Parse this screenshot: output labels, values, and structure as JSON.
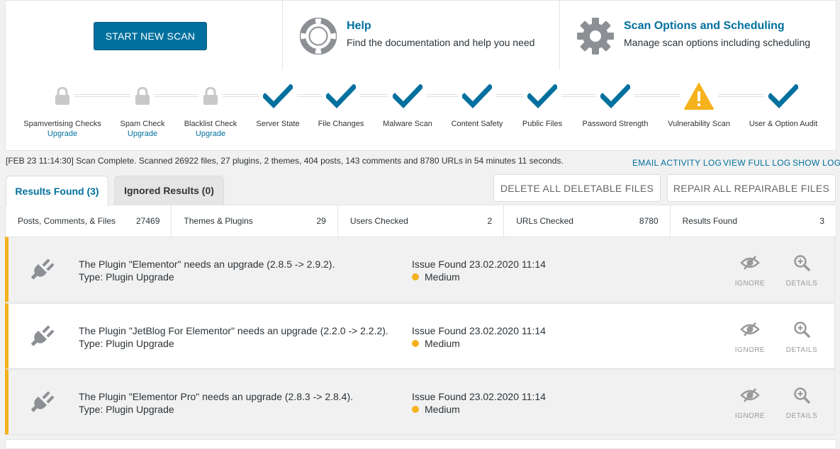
{
  "top": {
    "start_label": "START NEW SCAN",
    "help_title": "Help",
    "help_sub": "Find the documentation and help you need",
    "options_title": "Scan Options and Scheduling",
    "options_sub": "Manage scan options including scheduling"
  },
  "steps": [
    {
      "label": "Spamvertising Checks",
      "upgrade": "Upgrade",
      "icon": "lock-icon"
    },
    {
      "label": "Spam Check",
      "upgrade": "Upgrade",
      "icon": "lock-icon"
    },
    {
      "label": "Blacklist Check",
      "upgrade": "Upgrade",
      "icon": "lock-icon"
    },
    {
      "label": "Server State",
      "upgrade": "",
      "icon": "check-icon"
    },
    {
      "label": "File Changes",
      "upgrade": "",
      "icon": "check-icon"
    },
    {
      "label": "Malware Scan",
      "upgrade": "",
      "icon": "check-icon"
    },
    {
      "label": "Content Safety",
      "upgrade": "",
      "icon": "check-icon"
    },
    {
      "label": "Public Files",
      "upgrade": "",
      "icon": "check-icon"
    },
    {
      "label": "Password Strength",
      "upgrade": "",
      "icon": "check-icon"
    },
    {
      "label": "Vulnerability Scan",
      "upgrade": "",
      "icon": "warning-icon"
    },
    {
      "label": "User & Option Audit",
      "upgrade": "",
      "icon": "check-icon"
    }
  ],
  "log": {
    "text": "[FEB 23 11:14:30] Scan Complete. Scanned 26922 files, 27 plugins, 2 themes, 404 posts, 143 comments and 8780 URLs in 54 minutes 11 seconds.",
    "email_link": "EMAIL ACTIVITY LOG",
    "full_link": "VIEW FULL LOG",
    "show_link": "SHOW LOG"
  },
  "tabs": {
    "results": "Results Found (3)",
    "ignored": "Ignored Results (0)"
  },
  "actions": {
    "delete": "DELETE ALL DELETABLE FILES",
    "repair": "REPAIR ALL REPAIRABLE FILES"
  },
  "stats": [
    {
      "label": "Posts, Comments, & Files",
      "value": "27469"
    },
    {
      "label": "Themes & Plugins",
      "value": "29"
    },
    {
      "label": "Users Checked",
      "value": "2"
    },
    {
      "label": "URLs Checked",
      "value": "8780"
    },
    {
      "label": "Results Found",
      "value": "3"
    }
  ],
  "issues": [
    {
      "message": "The Plugin \"Elementor\" needs an upgrade (2.8.5 -> 2.9.2).",
      "type": "Type: Plugin Upgrade",
      "found": "Issue Found 23.02.2020 11:14",
      "severity": "Medium"
    },
    {
      "message": "The Plugin \"JetBlog For Elementor\" needs an upgrade (2.2.0 -> 2.2.2).",
      "type": "Type: Plugin Upgrade",
      "found": "Issue Found 23.02.2020 11:14",
      "severity": "Medium"
    },
    {
      "message": "The Plugin \"Elementor Pro\" needs an upgrade (2.8.3 -> 2.8.4).",
      "type": "Type: Plugin Upgrade",
      "found": "Issue Found 23.02.2020 11:14",
      "severity": "Medium"
    }
  ],
  "issue_actions": {
    "ignore": "IGNORE",
    "details": "DETAILS"
  },
  "colors": {
    "accent": "#00709e",
    "warning": "#f5b21d",
    "locked": "#c8c8c8"
  }
}
